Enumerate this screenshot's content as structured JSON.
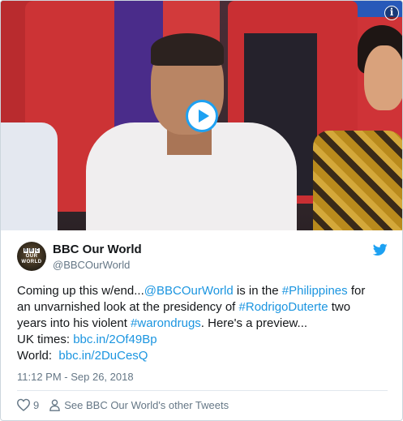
{
  "media": {
    "play_icon": "play-icon",
    "info_icon": "info-icon",
    "info_glyph": "i"
  },
  "tweet": {
    "author_name": "BBC Our World",
    "author_handle": "@BBCOurWorld",
    "avatar_text": {
      "brand": [
        "B",
        "B",
        "C"
      ],
      "line1": "OUR",
      "line2": "WORLD"
    },
    "platform_icon": "twitter-bird-icon",
    "body": {
      "line1": {
        "t1": "Coming up this w/end...",
        "mention": "@BBCOurWorld",
        "t2": " is in the ",
        "hashtag": "#Philippines",
        "t3": " for"
      },
      "line2": {
        "t1": "an unvarnished look at the presidency of ",
        "hashtag": "#RodrigoDuterte",
        "t2": " two"
      },
      "line3": {
        "t1": "years into his violent ",
        "hashtag": "#warondrugs",
        "t2": ". Here's a preview..."
      },
      "line4": {
        "label": "UK times: ",
        "link": "bbc.in/2Of49Bp"
      },
      "line5": {
        "label": "World:  ",
        "link": "bbc.in/2DuCesQ"
      }
    },
    "timestamp": "11:12 PM - Sep 26, 2018",
    "like_count": "9",
    "see_tweets_label": "See BBC Our World's other Tweets"
  },
  "colors": {
    "link": "#1b95e0",
    "twitter_blue": "#1da1f2",
    "muted": "#657786",
    "text": "#14171a"
  }
}
